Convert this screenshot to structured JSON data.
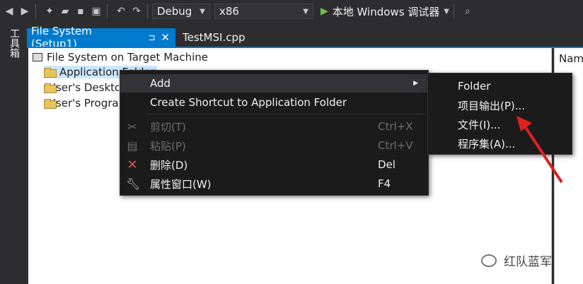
{
  "toolbar": {
    "config": "Debug",
    "platform": "x86",
    "run_label": "本地 Windows 调试器"
  },
  "side_panel": {
    "label": "工具箱"
  },
  "tabs": [
    {
      "label": "File System (Setup1)",
      "pin": "⊿",
      "close": "✕"
    },
    {
      "label": "TestMSI.cpp"
    }
  ],
  "tree": {
    "root": "File System on Target Machine",
    "items": [
      "Application Folder",
      "User's Desktop",
      "User's Programs Menu"
    ]
  },
  "right_pane": {
    "header": "Name"
  },
  "context_menu": {
    "items": [
      {
        "label": "Add",
        "shortcut": "",
        "icon": "",
        "has_submenu": true
      },
      {
        "label": "Create Shortcut to Application Folder",
        "shortcut": "",
        "icon": ""
      },
      {
        "label": "剪切(T)",
        "shortcut": "Ctrl+X",
        "icon": "scissors-icon"
      },
      {
        "label": "粘贴(P)",
        "shortcut": "Ctrl+V",
        "icon": "paste-icon"
      },
      {
        "label": "删除(D)",
        "shortcut": "Del",
        "icon": "delete-icon"
      },
      {
        "label": "属性窗口(W)",
        "shortcut": "F4",
        "icon": "wrench-icon"
      }
    ]
  },
  "submenu": {
    "items": [
      "Folder",
      "项目输出(P)...",
      "文件(I)...",
      "程序集(A)..."
    ]
  },
  "watermark": {
    "text": "红队蓝军"
  },
  "colors": {
    "accent": "#007acc",
    "arrow": "#e02020",
    "delete": "#e05050"
  }
}
